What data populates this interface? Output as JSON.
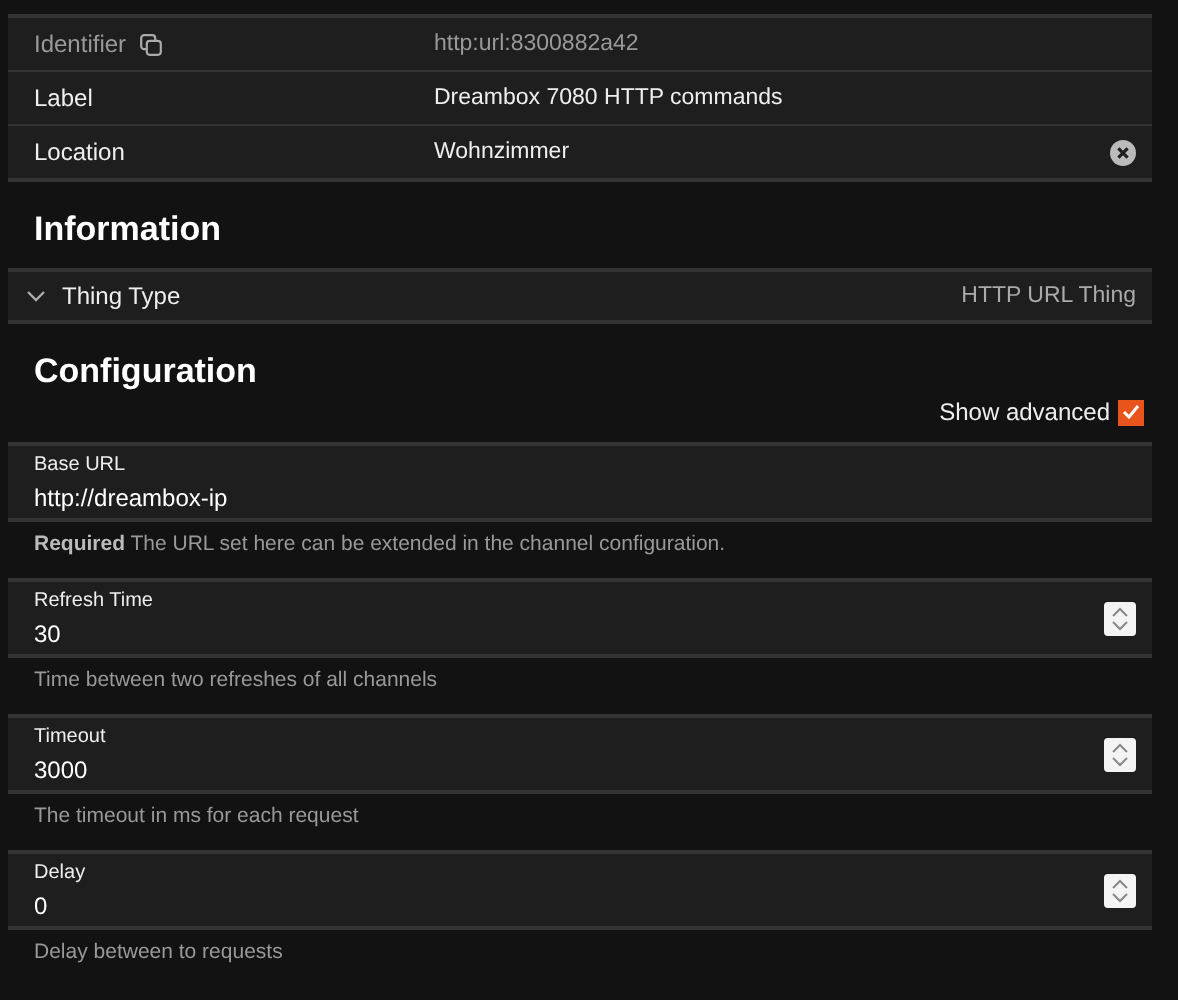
{
  "properties": [
    {
      "label": "Identifier",
      "value": "http:url:8300882a42",
      "muted": true,
      "kind": "copy"
    },
    {
      "label": "Label",
      "value": "Dreambox 7080 HTTP commands",
      "muted": false,
      "kind": "plain"
    },
    {
      "label": "Location",
      "value": "Wohnzimmer",
      "muted": false,
      "kind": "clear"
    }
  ],
  "information": {
    "title": "Information",
    "thing_type": {
      "label": "Thing Type",
      "value": "HTTP URL Thing",
      "expanded": false
    }
  },
  "configuration": {
    "title": "Configuration",
    "show_advanced": {
      "label": "Show advanced",
      "checked": true
    },
    "fields": [
      {
        "kind": "text",
        "label": "Base URL",
        "value": "http://dreambox-ip",
        "hint": "**Required** The URL set here can be extended in the channel configuration."
      },
      {
        "kind": "number",
        "label": "Refresh Time",
        "value": "30",
        "hint": "Time between two refreshes of all channels"
      },
      {
        "kind": "number",
        "label": "Timeout",
        "value": "3000",
        "hint": "The timeout in ms for each request"
      },
      {
        "kind": "number",
        "label": "Delay",
        "value": "0",
        "hint": "Delay between to requests"
      }
    ]
  }
}
